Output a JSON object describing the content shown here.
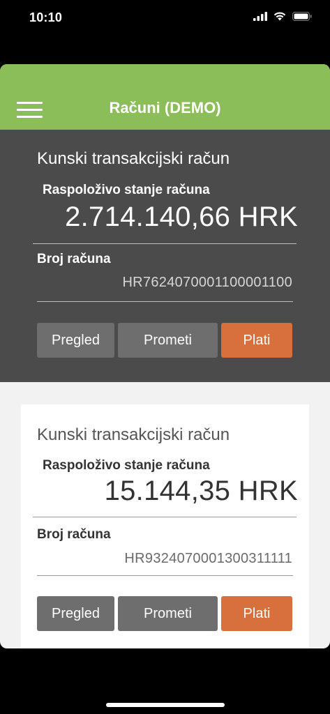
{
  "status": {
    "time": "10:10"
  },
  "header": {
    "title": "Računi (DEMO)"
  },
  "accounts": [
    {
      "name": "Kunski transakcijski račun",
      "balance_label": "Raspoloživo stanje računa",
      "balance": "2.714.140,66 HRK",
      "number_label": "Broj računa",
      "number": "HR7624070001100001100",
      "buttons": {
        "overview": "Pregled",
        "transactions": "Prometi",
        "pay": "Plati"
      }
    },
    {
      "name": "Kunski transakcijski račun",
      "balance_label": "Raspoloživo stanje računa",
      "balance": "15.144,35 HRK",
      "number_label": "Broj računa",
      "number": "HR9324070001300311111",
      "buttons": {
        "overview": "Pregled",
        "transactions": "Prometi",
        "pay": "Plati"
      }
    }
  ],
  "colors": {
    "brand": "#8bbe58",
    "card_dark": "#4b4b4b",
    "button_grey": "#6e6e6e",
    "button_pay": "#d8703e"
  }
}
